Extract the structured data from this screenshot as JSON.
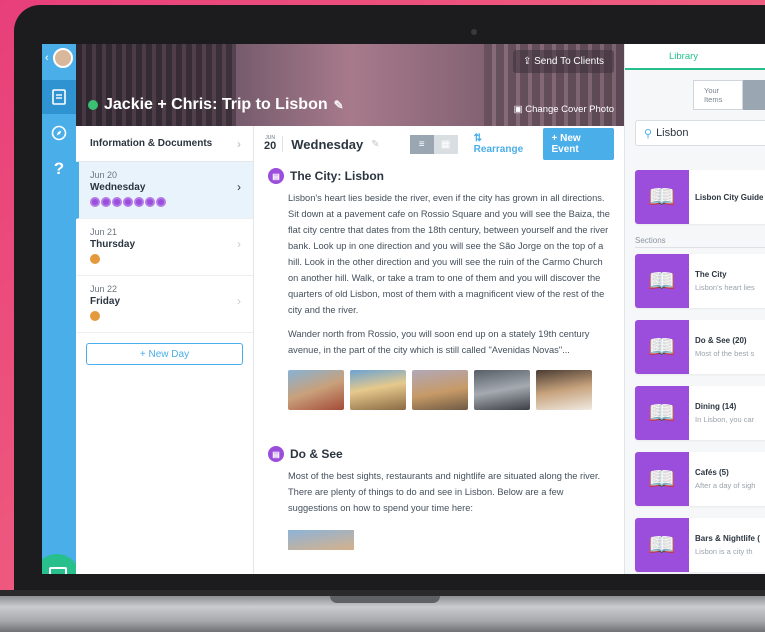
{
  "cover": {
    "trip_title": "Jackie + Chris: Trip to Lisbon",
    "send_button": "Send To Clients",
    "change_cover": "Change Cover Photo"
  },
  "sidebar": {
    "header": "Information & Documents",
    "days": [
      {
        "date": "Jun 20",
        "name": "Wednesday",
        "active": true,
        "icon_count": 7,
        "icon_color": "#9b4ddb"
      },
      {
        "date": "Jun 21",
        "name": "Thursday",
        "active": false,
        "icon_count": 1,
        "icon_color": "#e49a3c"
      },
      {
        "date": "Jun 22",
        "name": "Friday",
        "active": false,
        "icon_count": 1,
        "icon_color": "#e49a3c"
      }
    ],
    "new_day_label": "+ New Day"
  },
  "main": {
    "date_month": "JUN",
    "date_day": "20",
    "day_title": "Wednesday",
    "rearrange_label": "Rearrange",
    "new_event_label": "+ New Event",
    "sections": [
      {
        "title": "The City: Lisbon",
        "paragraphs": [
          "Lisbon's heart lies beside the river, even if the city has grown in all directions. Sit down at a pavement cafe on Rossio Square and you will see the Baiza, the flat city centre that dates from the 18th century, between yourself and the river bank. Look up in one direction and you will see the São Jorge on the top of a hill. Look in the other direction and you will see the ruin of the Carmo Church on another hill. Walk, or take a tram to one of them and you will discover the quarters of old Lisbon, most of them with a magnificent view of the rest of the city and the river.",
          "Wander north from Rossio, you will soon end up on a stately 19th century avenue, in the part of the city which is still called \"Avenidas Novas\"..."
        ]
      },
      {
        "title": "Do & See",
        "paragraphs": [
          "Most of the best sights, restaurants and nightlife are situated along the river. There are plenty of things to do and see in Lisbon. Below are a few suggestions on how to spend your time here:"
        ]
      }
    ]
  },
  "library": {
    "tab_label": "Library",
    "toggle_label": "Your Items",
    "search_value": "Lisbon",
    "guide": {
      "name": "Lisbon City Guide"
    },
    "sections_label": "Sections",
    "items": [
      {
        "name": "The City",
        "desc": "Lisbon's heart lies"
      },
      {
        "name": "Do & See (20)",
        "desc": "Most of the best s"
      },
      {
        "name": "Dining (14)",
        "desc": "In Lisbon, you car"
      },
      {
        "name": "Cafés (5)",
        "desc": "After a day of sigh"
      },
      {
        "name": "Bars & Nightlife (",
        "desc": "Lisbon is a city th"
      }
    ],
    "accent": "#9b4ddb"
  },
  "colors": {
    "primary_blue": "#4aaee9",
    "green": "#27c08d",
    "purple": "#9b4ddb",
    "background_pink": "#e83f7a"
  }
}
